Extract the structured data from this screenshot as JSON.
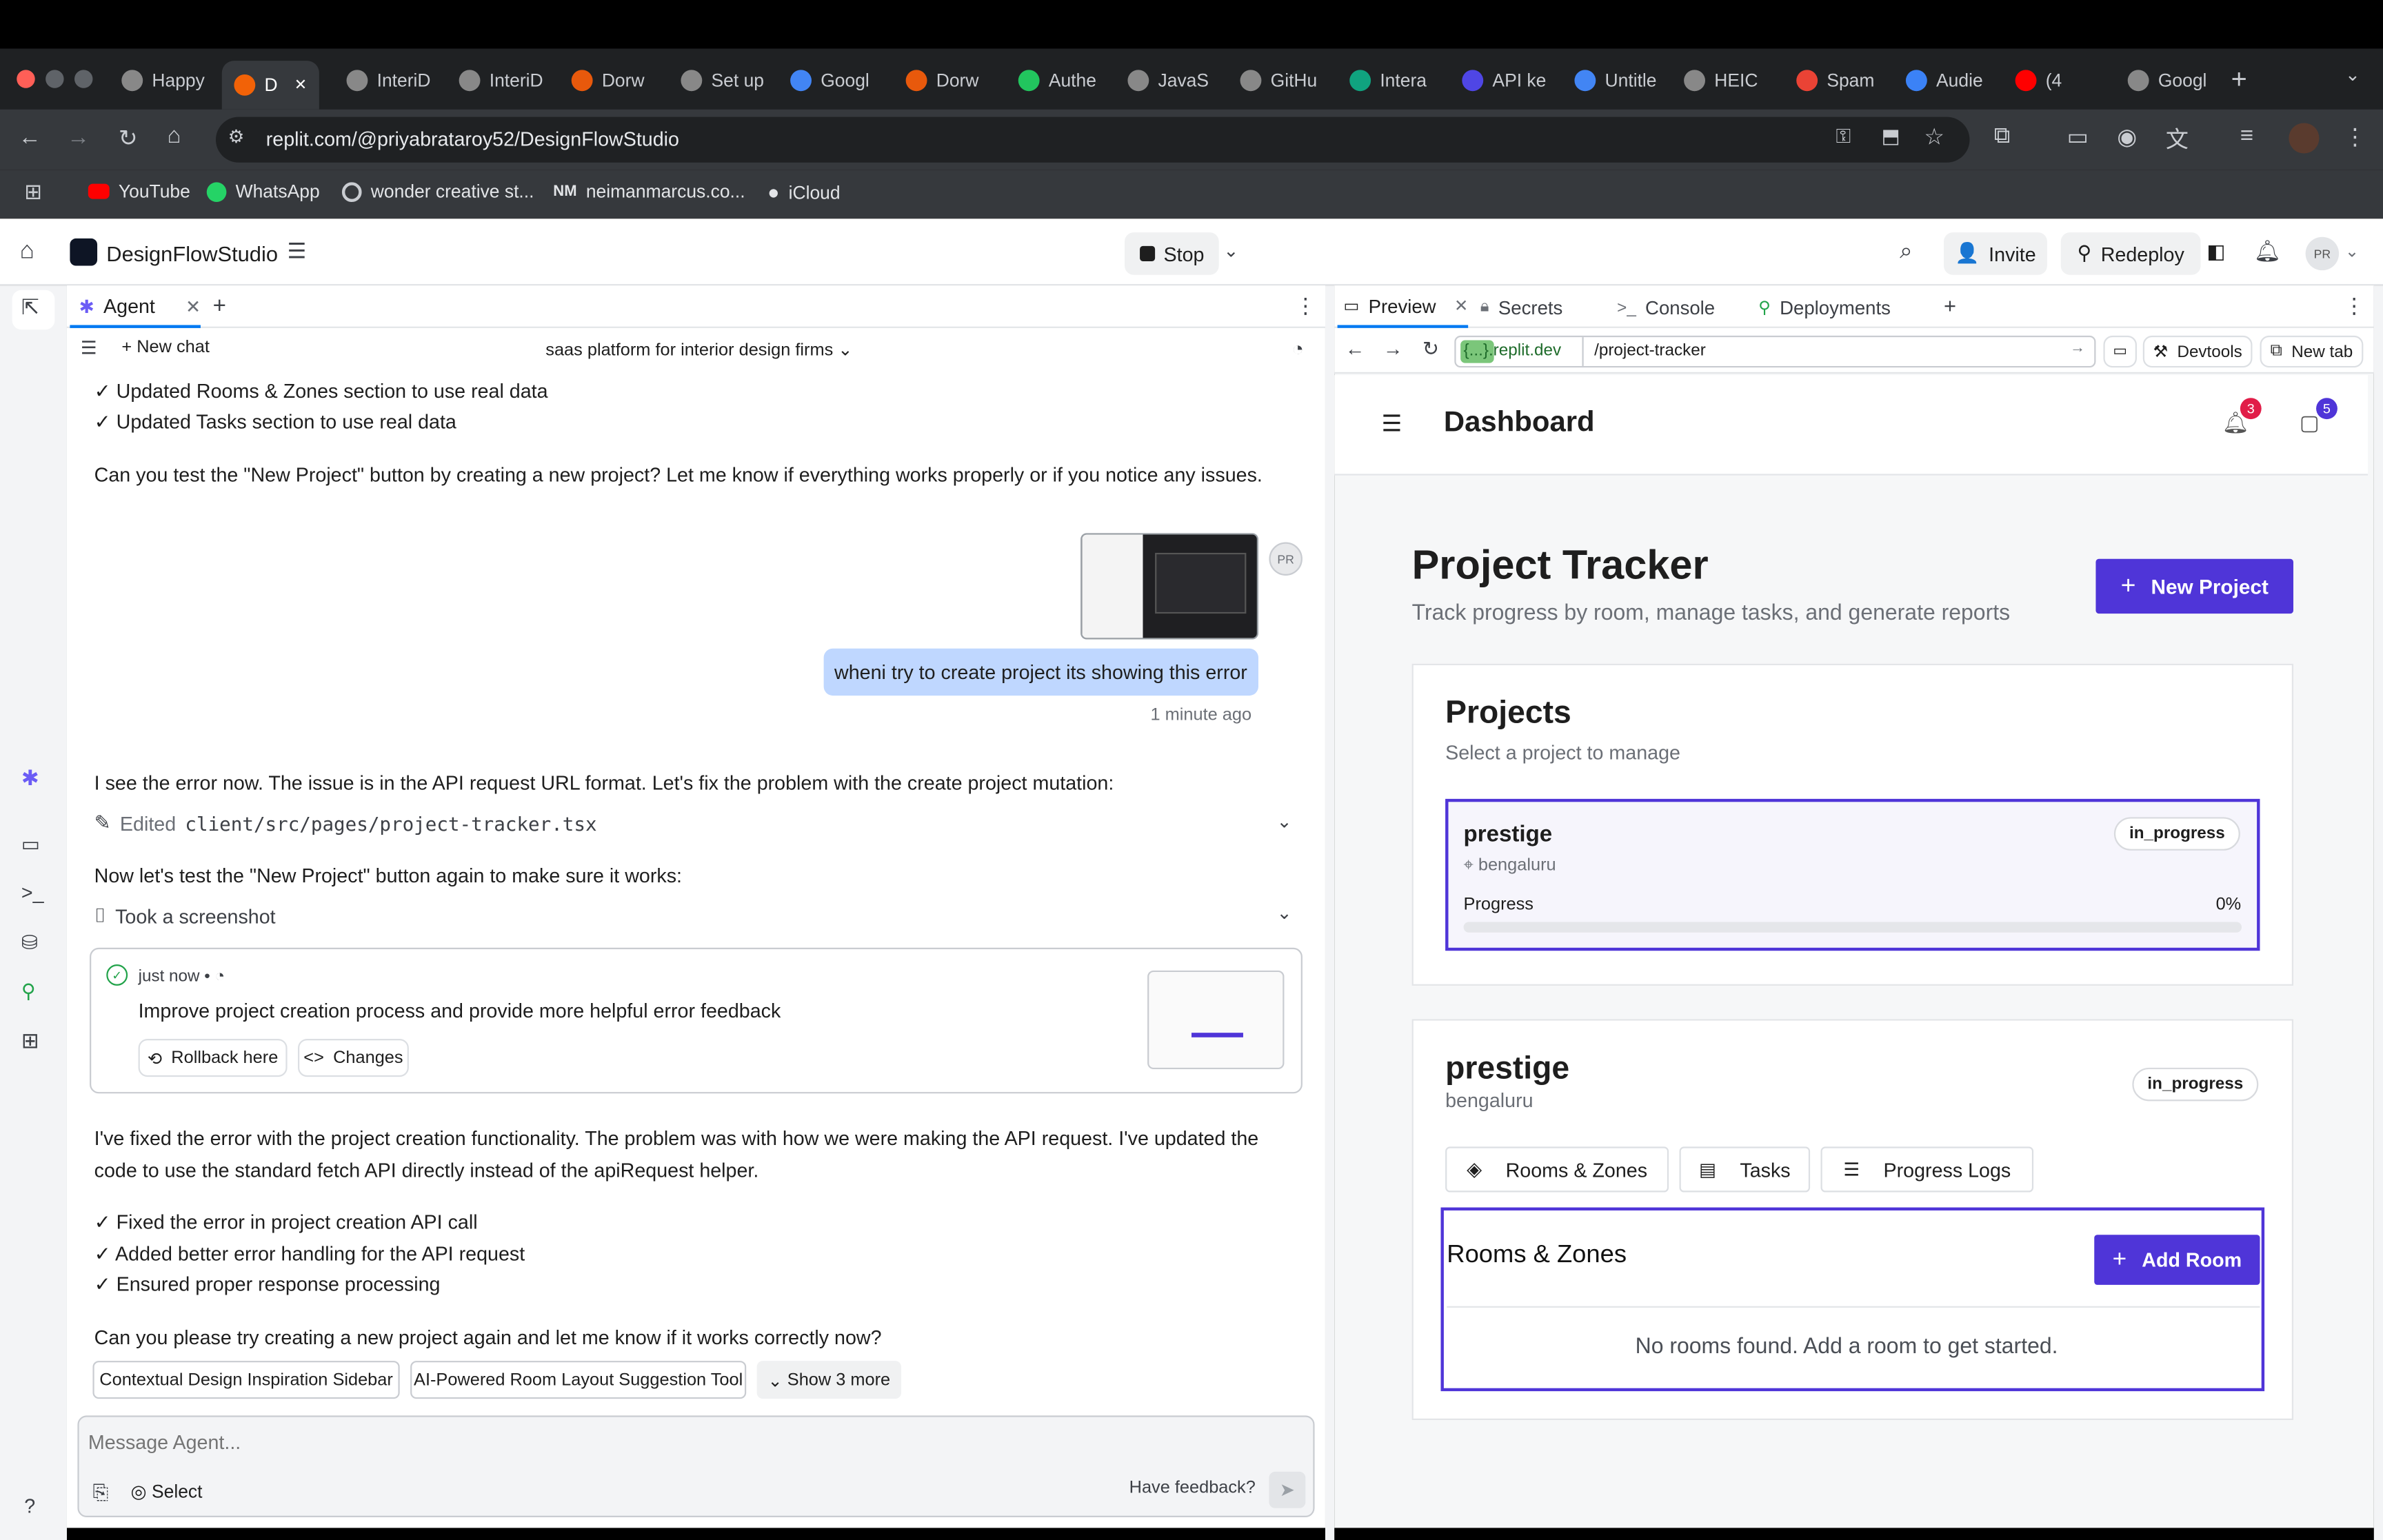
{
  "browser": {
    "tabs": [
      {
        "label": "Happy",
        "color": "#888"
      },
      {
        "label": "D",
        "color": "#f26207",
        "active": true
      },
      {
        "label": "InteriD",
        "color": "#888"
      },
      {
        "label": "InteriD",
        "color": "#888"
      },
      {
        "label": "Dorw",
        "color": "#e8590c"
      },
      {
        "label": "Set up",
        "color": "#888"
      },
      {
        "label": "Googl",
        "color": "#4285f4"
      },
      {
        "label": "Dorw",
        "color": "#e8590c"
      },
      {
        "label": "Authe",
        "color": "#22c55e"
      },
      {
        "label": "JavaS",
        "color": "#888"
      },
      {
        "label": "GitHu",
        "color": "#888"
      },
      {
        "label": "Intera",
        "color": "#10a37f"
      },
      {
        "label": "API ke",
        "color": "#4f46e5"
      },
      {
        "label": "Untitle",
        "color": "#4285f4"
      },
      {
        "label": "HEIC",
        "color": "#888"
      },
      {
        "label": "Spam",
        "color": "#ea4335"
      },
      {
        "label": "Audie",
        "color": "#3b82f6"
      },
      {
        "label": "(4",
        "color": "#ff0000"
      },
      {
        "label": "Googl",
        "color": "#888"
      }
    ],
    "url": "replit.com/@priyabrataroy52/DesignFlowStudio",
    "bookmarks": [
      "YouTube",
      "WhatsApp",
      "wonder creative st...",
      "neimanmarcus.co...",
      "iCloud"
    ]
  },
  "replit": {
    "project_name": "DesignFlowStudio",
    "stop_label": "Stop",
    "invite_label": "Invite",
    "redeploy_label": "Redeploy",
    "avatar": "PR"
  },
  "agent": {
    "tab_label": "Agent",
    "new_chat": "New chat",
    "chat_title": "saas platform for interior design firms",
    "lines_top": [
      "✓ Updated Rooms & Zones section to use real data",
      "✓ Updated Tasks section to use real data"
    ],
    "msg_test": "Can you test the \"New Project\" button by creating a new project? Let me know if everything works properly or if you notice any issues.",
    "user_msg": "wheni try to create project its showing this error",
    "user_time": "1 minute ago",
    "user_avatar": "PR",
    "msg_error": "I see the error now. The issue is in the API request URL format. Let's fix the problem with the create project mutation:",
    "edited_prefix": "Edited",
    "edited_file": "client/src/pages/project-tracker.tsx",
    "msg_retest": "Now let's test the \"New Project\" button again to make sure it works:",
    "screenshot_label": "Took a screenshot",
    "checkpoint": {
      "time": "just now",
      "title": "Improve project creation process and provide more helpful error feedback",
      "rollback": "Rollback here",
      "changes": "Changes"
    },
    "msg_fixed_1": "I've fixed the error with the project creation functionality. The problem was with how we were making the API request. I've updated the",
    "msg_fixed_2": "code to use the standard fetch API directly instead of the apiRequest helper.",
    "checks": [
      "✓ Fixed the error in project creation API call",
      "✓ Added better error handling for the API request",
      "✓ Ensured proper response processing"
    ],
    "msg_final": "Can you please try creating a new project again and let me know if it works correctly now?",
    "suggestions": [
      "Contextual Design Inspiration Sidebar",
      "AI-Powered Room Layout Suggestion Tool"
    ],
    "show_more": "Show 3 more",
    "input_placeholder": "Message Agent...",
    "select_label": "Select",
    "feedback": "Have feedback?"
  },
  "preview": {
    "tabs": [
      "Preview",
      "Secrets",
      "Console",
      "Deployments"
    ],
    "domain": "{...}.replit.dev",
    "path": "/project-tracker",
    "devtools": "Devtools",
    "new_tab": "New tab",
    "app": {
      "header_title": "Dashboard",
      "notif_count": "3",
      "msg_count": "5",
      "title": "Project Tracker",
      "subtitle": "Track progress by room, manage tasks, and generate reports",
      "new_project": "New Project",
      "projects_title": "Projects",
      "projects_sub": "Select a project to manage",
      "project": {
        "name": "prestige",
        "location": "bengaluru",
        "status": "in_progress",
        "progress_label": "Progress",
        "progress_value": "0%",
        "progress": 0
      },
      "detail": {
        "name": "prestige",
        "location": "bengaluru",
        "status": "in_progress",
        "tabs": [
          "Rooms & Zones",
          "Tasks",
          "Progress Logs"
        ],
        "section_title": "Rooms & Zones",
        "add_room": "Add Room",
        "empty": "No rooms found. Add a room to get started."
      }
    }
  }
}
